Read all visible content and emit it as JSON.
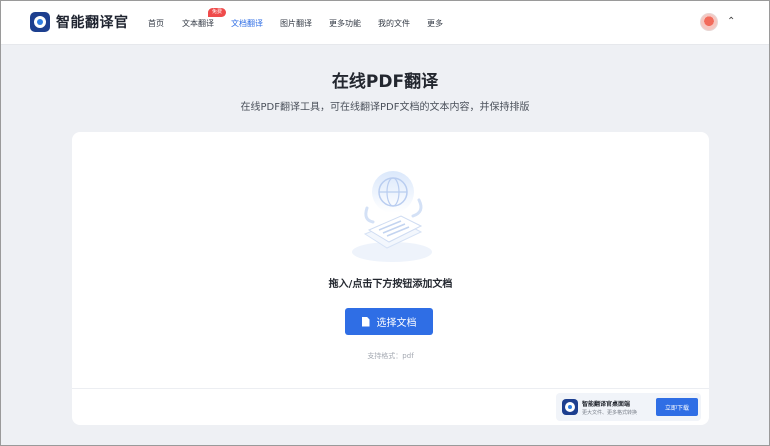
{
  "app": {
    "name": "智能翻译官"
  },
  "nav": {
    "items": [
      {
        "label": "首页",
        "active": false
      },
      {
        "label": "文本翻译",
        "active": false,
        "badge": "免费"
      },
      {
        "label": "文档翻译",
        "active": true
      },
      {
        "label": "图片翻译",
        "active": false
      },
      {
        "label": "更多功能",
        "active": false
      },
      {
        "label": "我的文件",
        "active": false
      },
      {
        "label": "更多",
        "active": false
      }
    ]
  },
  "page": {
    "title": "在线PDF翻译",
    "subtitle": "在线PDF翻译工具，可在线翻译PDF文档的文本内容，并保持排版"
  },
  "upload": {
    "hint": "拖入/点击下方按钮添加文档",
    "button_label": "选择文档",
    "formats": "支持格式：pdf"
  },
  "promo": {
    "title": "智能翻译官桌面端",
    "subtitle": "更大文件、更多格式转换",
    "download_label": "立即下载"
  },
  "colors": {
    "accent": "#2f6ee5",
    "badge": "#ef4b4b",
    "background": "#eef0f4"
  }
}
